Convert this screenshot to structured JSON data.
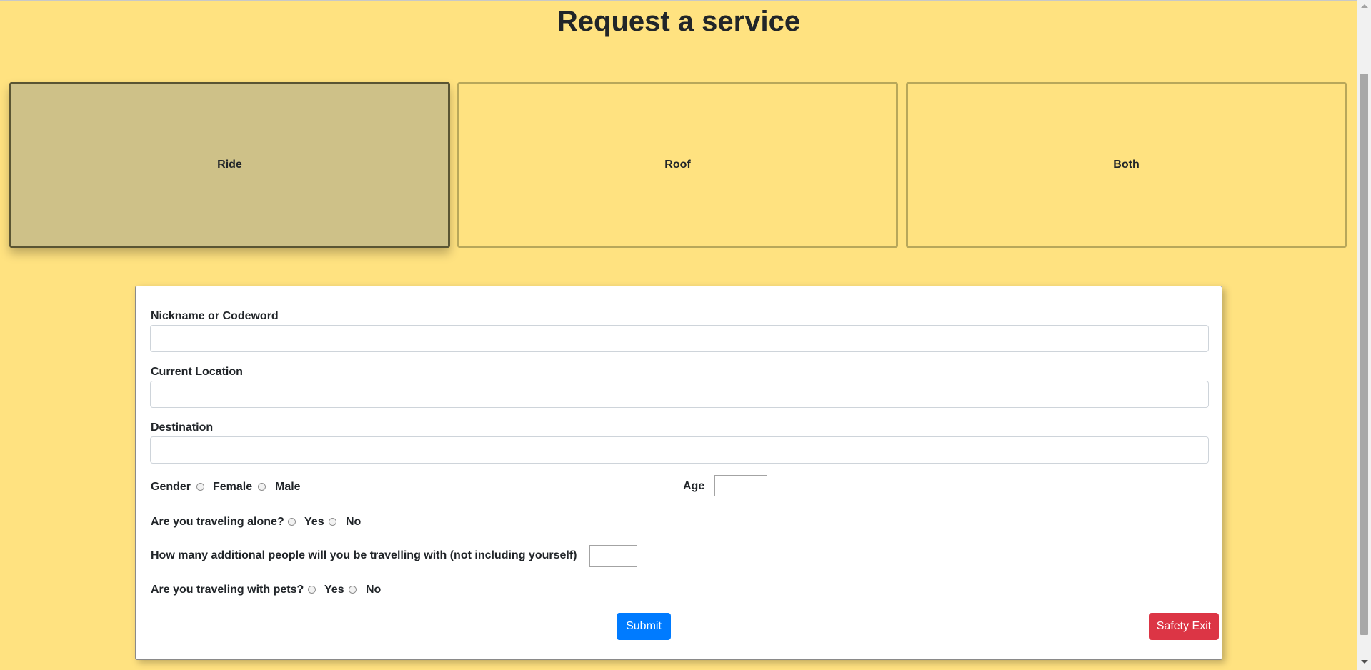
{
  "page": {
    "title": "Request a service"
  },
  "services": [
    {
      "label": "Ride",
      "selected": true
    },
    {
      "label": "Roof",
      "selected": false
    },
    {
      "label": "Both",
      "selected": false
    }
  ],
  "form": {
    "nickname_label": "Nickname or Codeword",
    "nickname_value": "",
    "location_label": "Current Location",
    "location_value": "",
    "destination_label": "Destination",
    "destination_value": "",
    "gender_label": "Gender",
    "gender_options": [
      "Female",
      "Male"
    ],
    "age_label": "Age",
    "age_value": "",
    "alone_label": "Are you traveling alone?",
    "alone_options": [
      "Yes",
      "No"
    ],
    "additional_people_label": "How many additional people will you be travelling with (not including yourself)",
    "additional_people_value": "",
    "pets_label": "Are you traveling with pets?",
    "pets_options": [
      "Yes",
      "No"
    ],
    "submit_label": "Submit",
    "safety_exit_label": "Safety Exit"
  },
  "colors": {
    "background": "#ffe280",
    "selected_card": "#cec188",
    "submit": "#007bff",
    "safety_exit": "#dc3545"
  }
}
